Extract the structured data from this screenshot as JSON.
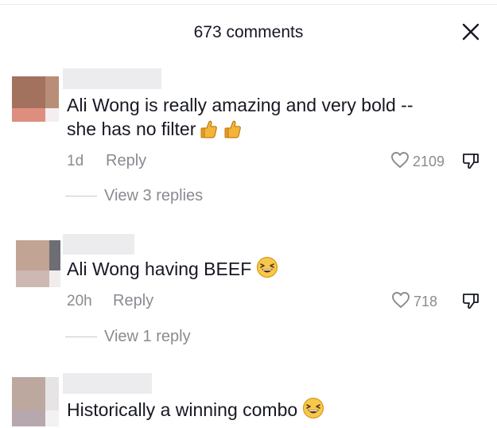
{
  "header": {
    "title": "673 comments"
  },
  "comments": [
    {
      "text_lines": [
        "Ali Wong is really amazing and very bold --",
        "she has no filter"
      ],
      "emojis": [
        "thumbs-up",
        "thumbs-up"
      ],
      "time": "1d",
      "reply_label": "Reply",
      "likes": "2109",
      "view_replies": "View 3 replies"
    },
    {
      "text_lines": [
        "Ali Wong having BEEF"
      ],
      "emojis": [
        "grinning-squinting-face"
      ],
      "time": "20h",
      "reply_label": "Reply",
      "likes": "718",
      "view_replies": "View 1 reply"
    },
    {
      "text_lines": [
        "Historically a winning combo"
      ],
      "emojis": [
        "grinning-squinting-face"
      ]
    }
  ],
  "colors": {
    "text": "#161823",
    "muted": "#8a8b91",
    "name_placeholder": "#ececee"
  },
  "icons": [
    "close-icon",
    "heart-icon",
    "thumbs-down-icon",
    "thumbs-up-emoji",
    "grinning-squinting-emoji"
  ]
}
